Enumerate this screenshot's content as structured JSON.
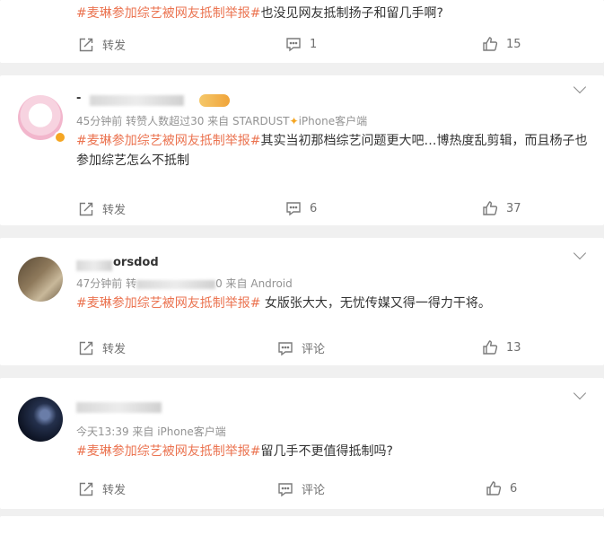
{
  "comments": [
    {
      "text_tag": "#麦琳参加综艺被网友抵制举报#",
      "text_body": "也没见网友抵制扬子和留几手啊?",
      "repost_label": "转发",
      "comment_label": "1",
      "like_count": "15"
    },
    {
      "username_visible": "- ",
      "meta": "45分钟前 转赞人数超过30  来自 STARDUST",
      "meta_suffix": "iPhone客户端",
      "text_tag": "#麦琳参加综艺被网友抵制举报#",
      "text_body": "其实当初那档综艺问题更大吧…博热度乱剪辑，而且杨子也参加综艺怎么不抵制",
      "repost_label": "转发",
      "comment_label": "6",
      "like_count": "37"
    },
    {
      "username_visible": "orsdod",
      "meta": "47分钟前 转",
      "meta_suffix": "0  来自 Android",
      "text_tag": "#麦琳参加综艺被网友抵制举报#",
      "text_body": " 女版张大大，无忧传媒又得一得力干将。",
      "repost_label": "转发",
      "comment_label": "评论",
      "like_count": "13"
    },
    {
      "meta": "今天13:39  来自 iPhone客户端",
      "text_tag": "#麦琳参加综艺被网友抵制举报#",
      "text_body": "留几手不更值得抵制吗?",
      "repost_label": "转发",
      "comment_label": "评论",
      "like_count": "6"
    }
  ],
  "colors": {
    "topic_tag": "#eb7350",
    "meta_text": "#939393",
    "background": "#f0f0f0"
  },
  "icons": [
    "repost-icon",
    "comment-icon",
    "like-icon",
    "chevron-down-icon",
    "verified-badge-icon",
    "sparkle-icon"
  ]
}
